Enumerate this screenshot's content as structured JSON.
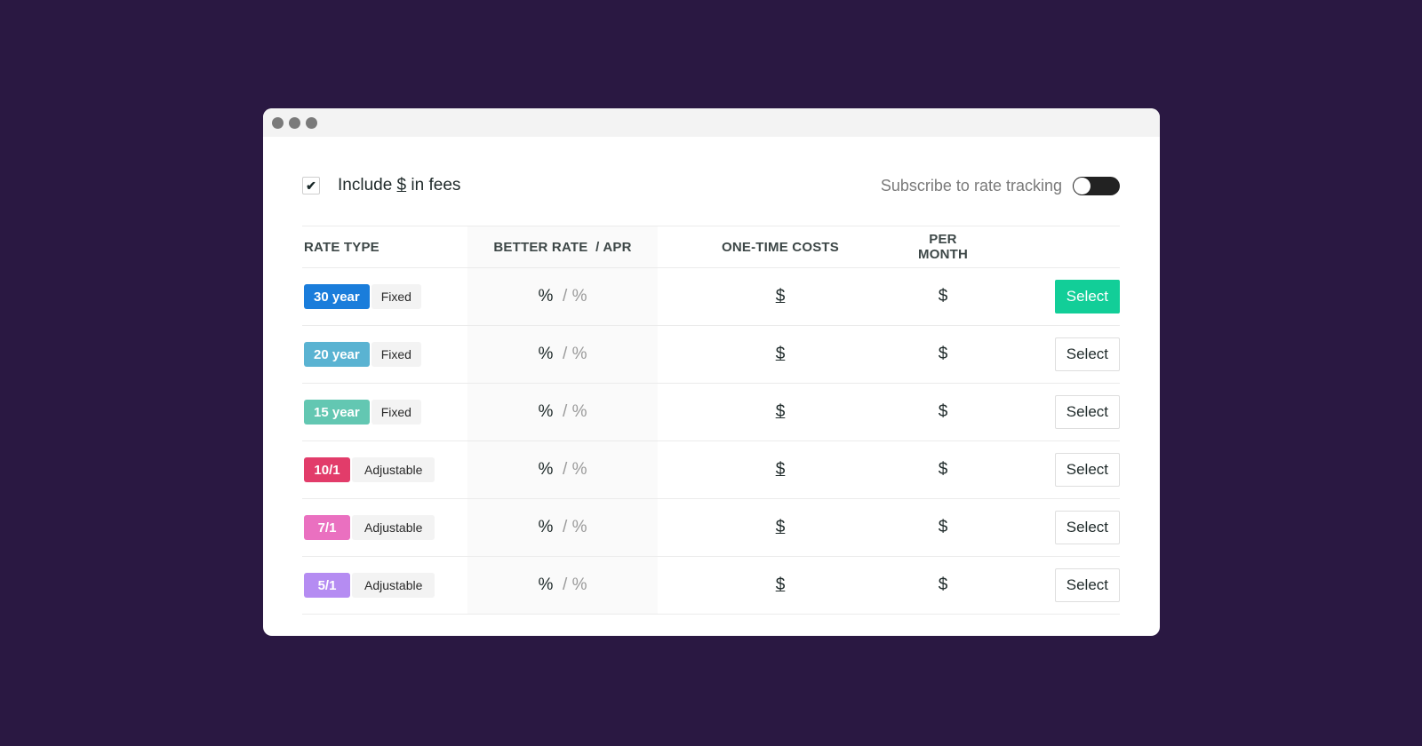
{
  "window": {
    "controls": [
      "close",
      "minimize",
      "maximize"
    ]
  },
  "fees": {
    "checked": true,
    "check_icon": "✔",
    "label_before": "Include ",
    "label_currency": "$",
    "label_after": " in fees"
  },
  "tracking": {
    "label": "Subscribe to rate tracking",
    "enabled": false
  },
  "table": {
    "headers": {
      "rate_type": "RATE TYPE",
      "better_rate": "BETTER RATE  / APR",
      "one_time": "ONE-TIME COSTS",
      "per_month": "PER MONTH"
    },
    "rows": [
      {
        "term": "30 year",
        "term_color": "#1a7ddb",
        "kind": "Fixed",
        "rate": "%",
        "sep": "/",
        "apr": "%",
        "one_time": "$",
        "per_month": "$",
        "action": "Select",
        "highlighted": true
      },
      {
        "term": "20 year",
        "term_color": "#5ab3d2",
        "kind": "Fixed",
        "rate": "%",
        "sep": "/",
        "apr": "%",
        "one_time": "$",
        "per_month": "$",
        "action": "Select",
        "highlighted": false
      },
      {
        "term": "15 year",
        "term_color": "#63c7b2",
        "kind": "Fixed",
        "rate": "%",
        "sep": "/",
        "apr": "%",
        "one_time": "$",
        "per_month": "$",
        "action": "Select",
        "highlighted": false
      },
      {
        "term": "10/1",
        "term_color": "#e23c6a",
        "kind": "Adjustable",
        "rate": "%",
        "sep": "/",
        "apr": "%",
        "one_time": "$",
        "per_month": "$",
        "action": "Select",
        "highlighted": false
      },
      {
        "term": "7/1",
        "term_color": "#ea70c0",
        "kind": "Adjustable",
        "rate": "%",
        "sep": "/",
        "apr": "%",
        "one_time": "$",
        "per_month": "$",
        "action": "Select",
        "highlighted": false
      },
      {
        "term": "5/1",
        "term_color": "#b58cf2",
        "kind": "Adjustable",
        "rate": "%",
        "sep": "/",
        "apr": "%",
        "one_time": "$",
        "per_month": "$",
        "action": "Select",
        "highlighted": false
      }
    ]
  },
  "colors": {
    "primary_action": "#12ce98",
    "background": "#2a1842"
  }
}
